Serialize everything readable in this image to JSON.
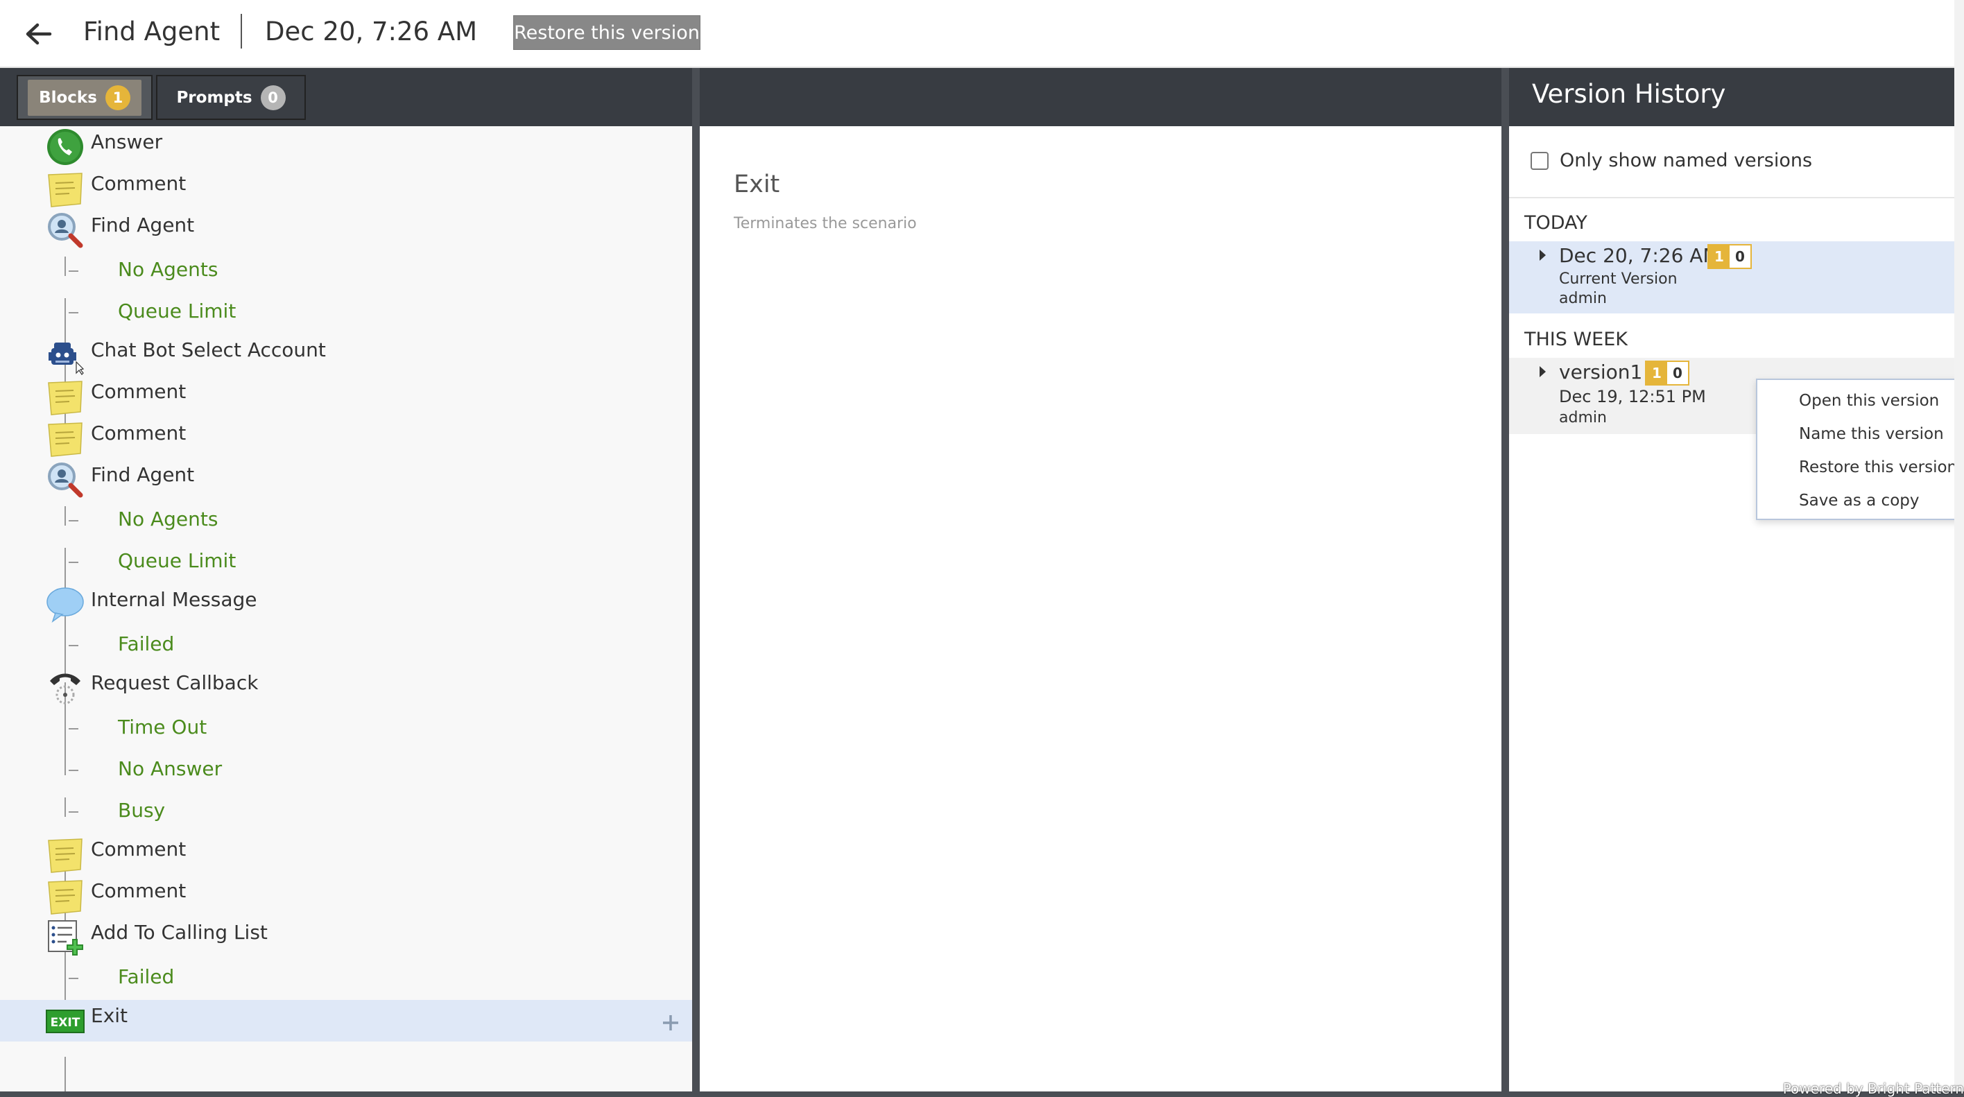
{
  "header": {
    "scenario_name": "Find Agent",
    "version_date": "Dec 20, 7:26 AM",
    "restore_label": "Restore this version"
  },
  "tabs": [
    {
      "label": "Blocks",
      "count": "1"
    },
    {
      "label": "Prompts",
      "count": "0"
    }
  ],
  "tree": [
    {
      "kind": "block",
      "label": "Answer",
      "icon": "phone-answer-icon"
    },
    {
      "kind": "block",
      "label": "Comment",
      "icon": "comment-note-icon"
    },
    {
      "kind": "block",
      "label": "Find Agent",
      "icon": "magnifier-agent-icon"
    },
    {
      "kind": "branch",
      "label": "No Agents"
    },
    {
      "kind": "branch",
      "label": "Queue Limit"
    },
    {
      "kind": "block",
      "label": "Chat Bot Select Account",
      "icon": "robot-icon"
    },
    {
      "kind": "block",
      "label": "Comment",
      "icon": "comment-note-icon"
    },
    {
      "kind": "block",
      "label": "Comment",
      "icon": "comment-note-icon"
    },
    {
      "kind": "block",
      "label": "Find Agent",
      "icon": "magnifier-agent-icon"
    },
    {
      "kind": "branch",
      "label": "No Agents"
    },
    {
      "kind": "branch",
      "label": "Queue Limit"
    },
    {
      "kind": "block",
      "label": "Internal Message",
      "icon": "speech-bubble-icon"
    },
    {
      "kind": "branch",
      "label": "Failed"
    },
    {
      "kind": "block",
      "label": "Request Callback",
      "icon": "callback-phone-icon"
    },
    {
      "kind": "branch",
      "label": "Time Out"
    },
    {
      "kind": "branch",
      "label": "No Answer"
    },
    {
      "kind": "branch",
      "label": "Busy"
    },
    {
      "kind": "block",
      "label": "Comment",
      "icon": "comment-note-icon"
    },
    {
      "kind": "block",
      "label": "Comment",
      "icon": "comment-note-icon"
    },
    {
      "kind": "block",
      "label": "Add To Calling List",
      "icon": "calling-list-add-icon"
    },
    {
      "kind": "branch",
      "label": "Failed"
    },
    {
      "kind": "block",
      "label": "Exit",
      "icon": "exit-icon",
      "selected": true
    }
  ],
  "exit_icon_text": "EXIT",
  "detail": {
    "title": "Exit",
    "description": "Terminates the scenario"
  },
  "version_history": {
    "title": "Version History",
    "filter_label": "Only show named versions",
    "groups": [
      {
        "header": "TODAY",
        "versions": [
          {
            "name": "Dec 20, 7:26 AM",
            "line2": "Current Version",
            "line3": "admin",
            "badge_blocks": "1",
            "badge_prompts": "0"
          }
        ]
      },
      {
        "header": "THIS WEEK",
        "versions": [
          {
            "name": "version1",
            "line2": "Dec 19, 12:51 PM",
            "line3": "admin",
            "badge_blocks": "1",
            "badge_prompts": "0"
          }
        ]
      }
    ]
  },
  "context_menu": [
    "Open this version",
    "Name this version",
    "Restore this version",
    "Save as a copy"
  ],
  "footer": {
    "powered_by": "Powered by Bright Pattern"
  },
  "colors": {
    "dark_bar": "#383c42",
    "branch_green": "#4b8b1d",
    "badge_gold": "#e5b53a",
    "selected_bg": "#dfe8f7"
  }
}
